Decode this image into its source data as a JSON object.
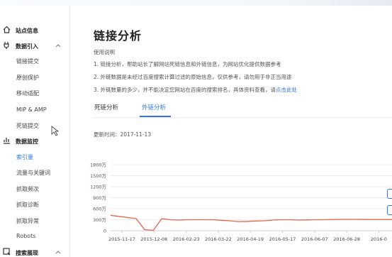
{
  "sidebar": {
    "items": [
      {
        "label": "站点信息",
        "type": "group",
        "icon": "home-icon"
      },
      {
        "label": "数据引入",
        "type": "group",
        "icon": "plug-icon",
        "expanded": true
      },
      {
        "label": "链接提交",
        "type": "item"
      },
      {
        "label": "原创保护",
        "type": "item"
      },
      {
        "label": "移动适配",
        "type": "item"
      },
      {
        "label": "MIP & AMP",
        "type": "item"
      },
      {
        "label": "死链提交",
        "type": "item"
      },
      {
        "label": "数据监控",
        "type": "group",
        "icon": "chart-icon"
      },
      {
        "label": "索引量",
        "type": "item",
        "active": true
      },
      {
        "label": "流量与关键词",
        "type": "item"
      },
      {
        "label": "抓取频次",
        "type": "item"
      },
      {
        "label": "抓取诊断",
        "type": "item"
      },
      {
        "label": "抓取异常",
        "type": "item"
      },
      {
        "label": "Robots",
        "type": "item"
      },
      {
        "label": "搜索展现",
        "type": "group",
        "icon": "search-display-icon",
        "expanded": true
      }
    ]
  },
  "main": {
    "title": "链接分析",
    "help_title": "使用说明",
    "help_lines": [
      "1. 链接分析，帮助站长了解网站死链信息和外链信息，为网站优化提供数据参考",
      "2. 外链数据是未经过百度搜索计算过滤的原始信息，仅供参考，请勿用于非正当用途",
      "3. 外链数量的多少，并不能决定您网站在百度的搜索排名，具体资料查看，请"
    ],
    "help_link": "点击此处",
    "tabs": [
      {
        "label": "死链分析",
        "active": false
      },
      {
        "label": "外链分析",
        "active": true
      }
    ],
    "update_label": "更新时间：",
    "update_time": "2017-11-13"
  },
  "colors": {
    "accent": "#2f78e6",
    "series": "#e8624d"
  },
  "chart_data": {
    "type": "line",
    "y_tick_labels": [
      "0",
      "300万",
      "600万",
      "900万",
      "1200万",
      "1500万",
      "1800万"
    ],
    "ylim": [
      0,
      1800
    ],
    "x_tick_labels": [
      "2015-11-17",
      "2015-12-08",
      "2016-02-23",
      "2016-03-22",
      "2016-04-19",
      "2016-05-17",
      "2016-06-07",
      "2016-06-28",
      "2016-0"
    ],
    "grid": true,
    "series": [
      {
        "values": [
          420,
          390,
          360,
          330,
          30,
          10,
          330,
          300,
          290,
          300,
          300,
          300,
          300,
          285,
          270,
          250,
          255,
          265,
          270,
          290,
          300,
          300,
          290,
          295,
          300,
          300,
          305,
          310,
          310,
          310,
          305,
          305,
          305,
          305
        ]
      }
    ]
  }
}
